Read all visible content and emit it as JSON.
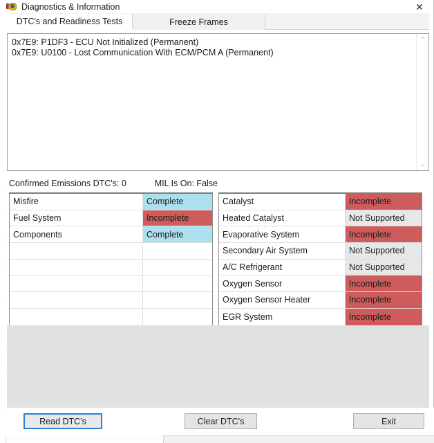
{
  "window": {
    "title": "Diagnostics & Information",
    "icon": "obd-connector-icon",
    "close_label": "✕"
  },
  "tabs": [
    {
      "label": "DTC's and Readiness Tests",
      "active": true
    },
    {
      "label": "Freeze Frames",
      "active": false
    }
  ],
  "dtc_list": {
    "lines": [
      "0x7E9: P1DF3 - ECU Not Initialized (Permanent)",
      "0x7E9: U0100 - Lost Communication With ECM/PCM A (Permanent)"
    ],
    "scroll_up": "⌃",
    "scroll_down": "⌄"
  },
  "status": {
    "confirmed_label": "Confirmed Emissions DTC's: 0",
    "mil_label": "MIL Is On: False"
  },
  "readiness": {
    "left": [
      {
        "name": "Misfire",
        "value": "Complete",
        "state": "complete"
      },
      {
        "name": "Fuel System",
        "value": "Incomplete",
        "state": "incomplete"
      },
      {
        "name": "Components",
        "value": "Complete",
        "state": "complete"
      },
      {
        "name": "",
        "value": "",
        "state": "empty"
      },
      {
        "name": "",
        "value": "",
        "state": "empty"
      },
      {
        "name": "",
        "value": "",
        "state": "empty"
      },
      {
        "name": "",
        "value": "",
        "state": "empty"
      },
      {
        "name": "",
        "value": "",
        "state": "empty"
      }
    ],
    "right": [
      {
        "name": "Catalyst",
        "value": "Incomplete",
        "state": "incomplete"
      },
      {
        "name": "Heated Catalyst",
        "value": "Not Supported",
        "state": "notsupported"
      },
      {
        "name": "Evaporative System",
        "value": "Incomplete",
        "state": "incomplete"
      },
      {
        "name": "Secondary Air System",
        "value": "Not Supported",
        "state": "notsupported"
      },
      {
        "name": "A/C Refrigerant",
        "value": "Not Supported",
        "state": "notsupported"
      },
      {
        "name": "Oxygen Sensor",
        "value": "Incomplete",
        "state": "incomplete"
      },
      {
        "name": "Oxygen Sensor Heater",
        "value": "Incomplete",
        "state": "incomplete"
      },
      {
        "name": "EGR System",
        "value": "Incomplete",
        "state": "incomplete"
      }
    ]
  },
  "buttons": {
    "read": "Read DTC's",
    "clear": "Clear DTC's",
    "exit": "Exit"
  },
  "colors": {
    "complete": "#ade0ef",
    "incomplete": "#cf5c5c",
    "not_supported": "#e7e7e7",
    "focus_border": "#2b7fd4"
  }
}
